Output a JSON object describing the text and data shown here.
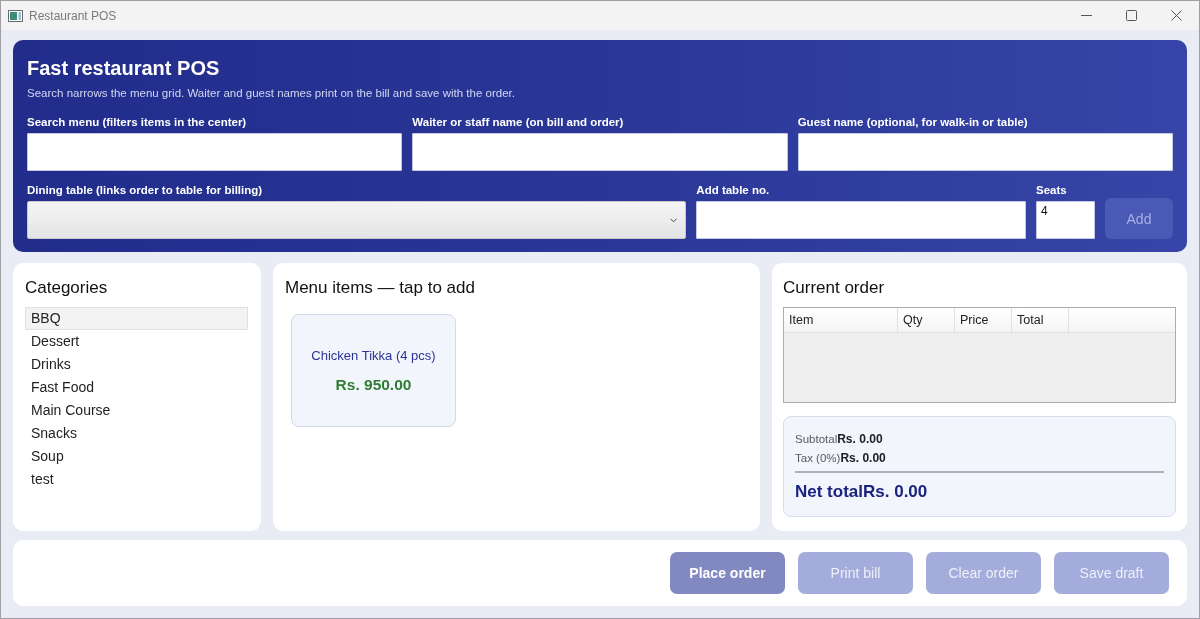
{
  "window": {
    "title": "Restaurant POS"
  },
  "header": {
    "title": "Fast restaurant POS",
    "subtitle": "Search narrows the menu grid. Waiter and guest names print on the bill and save with the order.",
    "field_rows": [
      {
        "fields": [
          {
            "kind": "text",
            "label": "Search menu (filters items in the center)"
          },
          {
            "kind": "text",
            "label": "Waiter or staff name (on bill and order)"
          },
          {
            "kind": "text",
            "label": "Guest name (optional, for walk-in or table)"
          }
        ]
      },
      {
        "fields": [
          {
            "kind": "select",
            "label": "Dining table (links order to table for billing)"
          },
          {
            "kind": "text",
            "label": "Add table no."
          },
          {
            "kind": "number",
            "label": "Seats",
            "value": "4"
          }
        ],
        "button": {
          "label": "Add",
          "disabled": true
        }
      }
    ]
  },
  "categories": {
    "title": "Categories",
    "items": [
      {
        "label": "BBQ",
        "selected": true
      },
      {
        "label": "Dessert",
        "selected": false
      },
      {
        "label": "Drinks",
        "selected": false
      },
      {
        "label": "Fast Food",
        "selected": false
      },
      {
        "label": "Main Course",
        "selected": false
      },
      {
        "label": "Snacks",
        "selected": false
      },
      {
        "label": "Soup",
        "selected": false
      },
      {
        "label": "test",
        "selected": false
      }
    ]
  },
  "menu": {
    "title": "Menu items — tap to add",
    "items": [
      {
        "name": "Chicken Tikka (4 pcs)",
        "price": "Rs. 950.00"
      }
    ]
  },
  "order": {
    "title": "Current order",
    "columns": [
      "Item",
      "Qty",
      "Price",
      "Total"
    ],
    "totals": [
      {
        "label": "Subtotal",
        "value": "Rs. 0.00"
      },
      {
        "label": "Tax (0%)",
        "value": "Rs. 0.00"
      }
    ],
    "net_total": {
      "label": "Net total",
      "value": "Rs. 0.00"
    }
  },
  "actions": [
    {
      "label": "Place order",
      "kind": "primary",
      "disabled": true
    },
    {
      "label": "Print bill",
      "kind": "secondary",
      "disabled": true
    },
    {
      "label": "Clear order",
      "kind": "secondary",
      "disabled": true
    },
    {
      "label": "Save draft",
      "kind": "secondary",
      "disabled": true
    }
  ]
}
